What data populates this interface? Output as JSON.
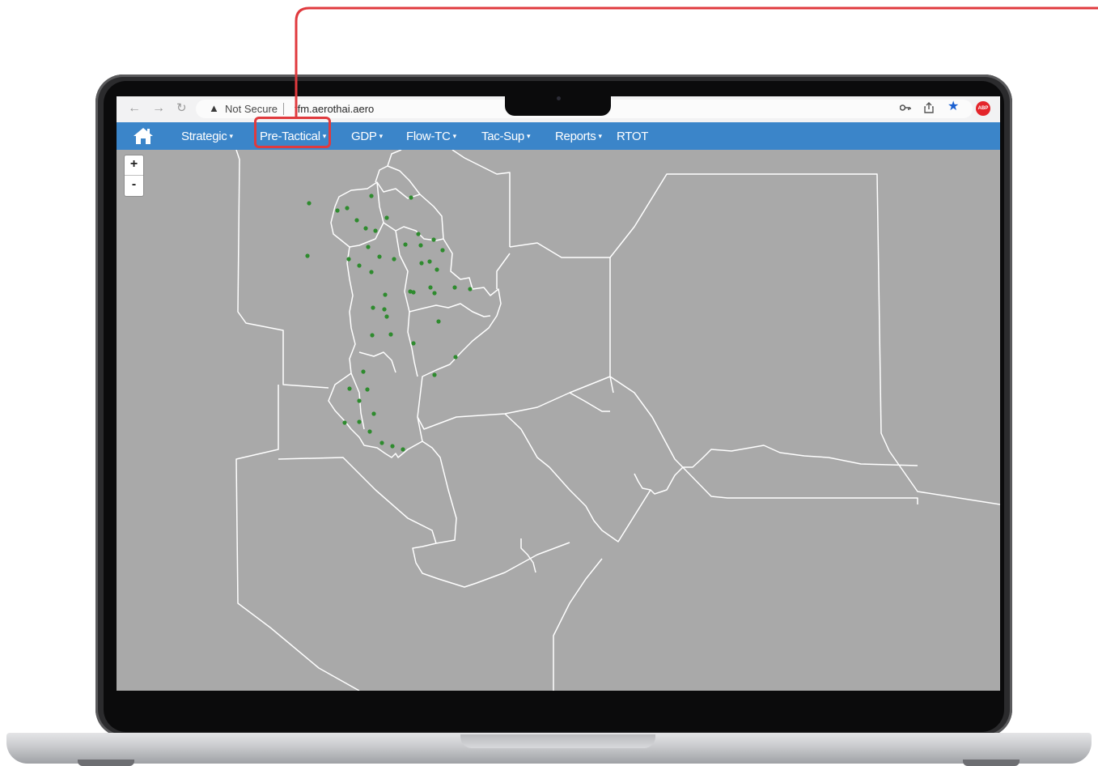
{
  "browser": {
    "security_label": "Not Secure",
    "url": "tfm.aerothai.aero",
    "icons": [
      "back-arrow-icon",
      "forward-arrow-icon",
      "reload-icon",
      "warning-icon",
      "key-icon",
      "share-icon",
      "star-icon",
      "adblock-icon"
    ]
  },
  "nav": {
    "home_icon": "home-icon",
    "items": [
      {
        "label": "Strategic",
        "caret": "▾"
      },
      {
        "label": "Pre-Tactical",
        "caret": "▾"
      },
      {
        "label": "GDP",
        "caret": "▾"
      },
      {
        "label": "Flow-TC",
        "caret": "▾"
      },
      {
        "label": "Tac-Sup",
        "caret": "▾"
      },
      {
        "label": "Reports",
        "caret": "▾"
      },
      {
        "label": "RTOT",
        "caret": ""
      }
    ],
    "highlighted_item": "Pre-Tactical"
  },
  "map": {
    "zoom_in": "+",
    "zoom_out": "-",
    "background_color": "#a9a9a9",
    "boundary_color": "#ffffff",
    "point_color": "#2e8b2e"
  },
  "colors": {
    "nav_bar": "#3b85c9",
    "callout": "#e03a3e"
  }
}
